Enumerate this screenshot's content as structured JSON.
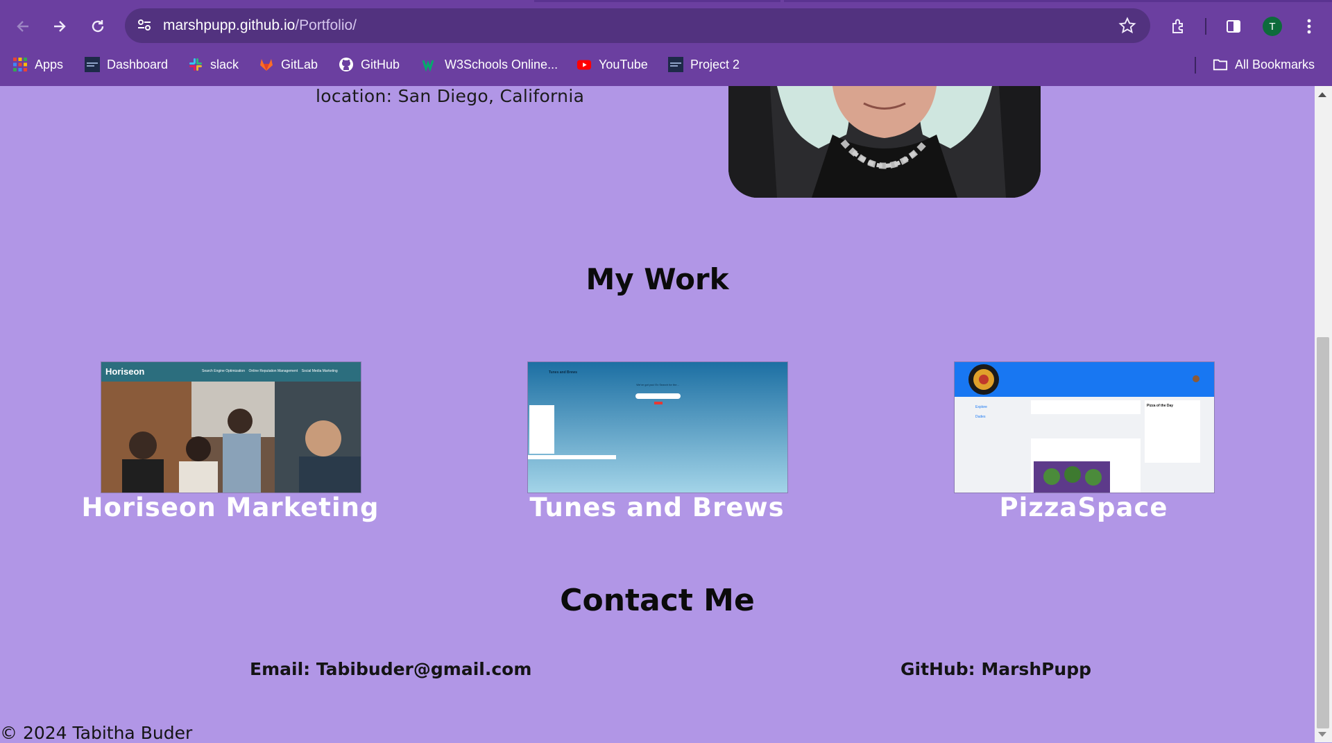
{
  "browser": {
    "url_host": "marshpupp.github.io",
    "url_path": "/Portfolio/",
    "profile_initial": "T",
    "bookmarks": [
      {
        "label": "Apps",
        "icon": "apps-grid-icon"
      },
      {
        "label": "Dashboard",
        "icon": "dashboard-icon"
      },
      {
        "label": "slack",
        "icon": "slack-icon"
      },
      {
        "label": "GitLab",
        "icon": "gitlab-icon"
      },
      {
        "label": "GitHub",
        "icon": "github-icon"
      },
      {
        "label": "W3Schools Online...",
        "icon": "w3schools-icon"
      },
      {
        "label": "YouTube",
        "icon": "youtube-icon"
      },
      {
        "label": "Project 2",
        "icon": "project-icon"
      }
    ],
    "all_bookmarks_label": "All Bookmarks",
    "colors": {
      "chrome": "#6b3fa0",
      "omnibox": "#52327f",
      "page": "#b196e6"
    }
  },
  "about": {
    "location": "location: San Diego, California"
  },
  "work": {
    "title": "My Work",
    "projects": [
      {
        "caption": "Horiseon Marketing",
        "thumb_brand": "Horiseon",
        "thumb_nav": [
          "Search Engine Optimization",
          "Online Reputation Management",
          "Social Media Marketing"
        ]
      },
      {
        "caption": "Tunes and Brews",
        "thumb_title": "Tunes and Brews",
        "thumb_text_1": "We've got you! Ex Search for the..."
      },
      {
        "caption": "PizzaSpace",
        "thumb_side": [
          "Explore",
          "Dudes"
        ],
        "thumb_panel_title": "Pizza of the Day"
      }
    ]
  },
  "contact": {
    "title": "Contact Me",
    "email": "Email: Tabibuder@gmail.com",
    "github": "GitHub: MarshPupp"
  },
  "footer": "© 2024 Tabitha Buder"
}
